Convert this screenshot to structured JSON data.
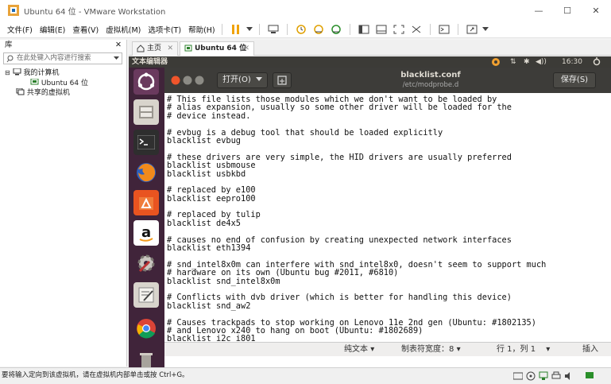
{
  "window": {
    "title": "Ubuntu 64 位 - VMware Workstation",
    "minimize": "—",
    "maximize": "☐",
    "close": "✕"
  },
  "menu": [
    "文件(F)",
    "编辑(E)",
    "查看(V)",
    "虚拟机(M)",
    "选项卡(T)",
    "帮助(H)"
  ],
  "library": {
    "title": "库",
    "close": "✕",
    "search_placeholder": "在此处键入内容进行搜索",
    "tree": {
      "my_computer": "我的计算机",
      "vm": "Ubuntu 64 位",
      "shared": "共享的虚拟机"
    }
  },
  "tabs": [
    {
      "label": "主页",
      "close": "✕"
    },
    {
      "label": "Ubuntu 64 位",
      "close": "✕"
    }
  ],
  "ubuntu": {
    "app_title": "文本编辑器",
    "clock": "16:30",
    "indicators": [
      "⇅",
      "✱",
      "◀))"
    ]
  },
  "gedit": {
    "open_label": "打开(O)",
    "file_name": "blacklist.conf",
    "file_path": "/etc/modprobe.d",
    "save_label": "保存(S)",
    "lines": [
      "# This file lists those modules which we don't want to be loaded by",
      "# alias expansion, usually so some other driver will be loaded for the",
      "# device instead.",
      "",
      "# evbug is a debug tool that should be loaded explicitly",
      "blacklist evbug",
      "",
      "# these drivers are very simple, the HID drivers are usually preferred",
      "blacklist usbmouse",
      "blacklist usbkbd",
      "",
      "# replaced by e100",
      "blacklist eepro100",
      "",
      "# replaced by tulip",
      "blacklist de4x5",
      "",
      "# causes no end of confusion by creating unexpected network interfaces",
      "blacklist eth1394",
      "",
      "# snd_intel8x0m can interfere with snd_intel8x0, doesn't seem to support much",
      "# hardware on its own (Ubuntu bug #2011, #6810)",
      "blacklist snd_intel8x0m",
      "",
      "# Conflicts with dvb driver (which is better for handling this device)",
      "blacklist snd_aw2",
      "",
      "# Causes trackpads to stop working on Lenovo 11e 2nd gen (Ubuntu: #1802135)",
      "# and Lenovo x240 to hang on boot (Ubuntu: #1802689)",
      "blacklist i2c_i801"
    ],
    "status": {
      "lang": "纯文本",
      "tab_width": "制表符宽度：8",
      "position": "行 1，列 1",
      "mode": "插入"
    }
  },
  "statusbar": {
    "message": "要将输入定向到该虚拟机，请在虚拟机内部单击或按 Ctrl+G。"
  },
  "colors": {
    "ubuntu_bg": "#2c001e",
    "launcher": "#40243a",
    "header": "#3d3c39",
    "close_btn": "#f0552b"
  }
}
